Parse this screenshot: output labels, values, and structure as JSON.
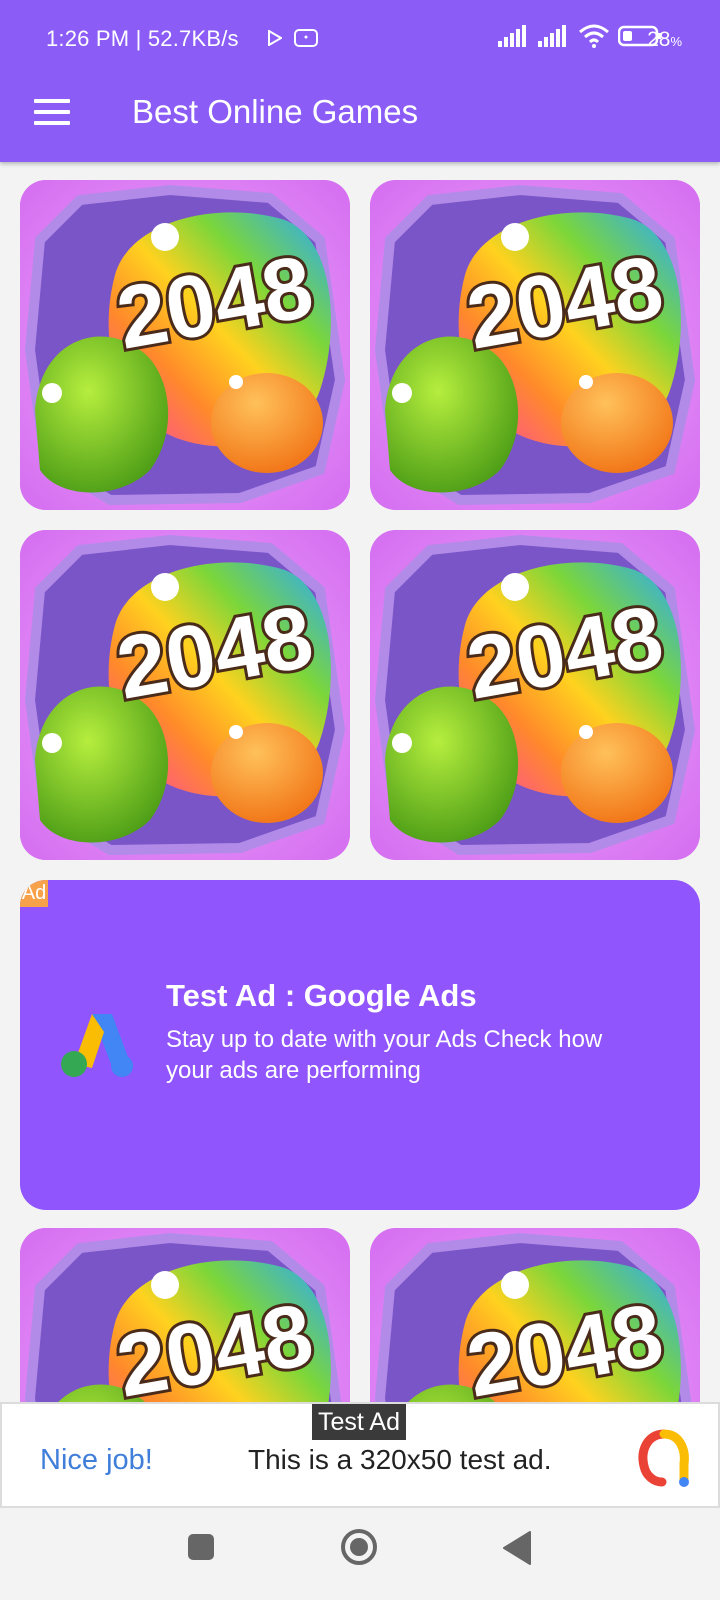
{
  "status_bar": {
    "time_speed": "1:26 PM | 52.7KB/s",
    "battery_percent": "28",
    "battery_unit": "%",
    "icons": [
      "play-icon",
      "sim-badge-icon",
      "signal-icon",
      "signal-icon",
      "wifi-icon",
      "battery-icon"
    ]
  },
  "app_bar": {
    "title": "Best Online Games",
    "menu_icon": "hamburger-menu-icon"
  },
  "games": [
    {
      "label": "2048"
    },
    {
      "label": "2048"
    },
    {
      "label": "2048"
    },
    {
      "label": "2048"
    },
    {
      "label": "2048"
    },
    {
      "label": "2048"
    }
  ],
  "native_ad": {
    "badge": "Ad",
    "headline": "Test Ad : Google Ads",
    "body": "Stay up to date with your Ads Check how your ads are performing",
    "logo_icon": "google-ads-logo-icon"
  },
  "banner_ad": {
    "tag": "Test Ad",
    "cta": "Nice job!",
    "text": "This is a 320x50 test ad.",
    "logo_icon": "admob-logo-icon"
  },
  "nav_bar": {
    "icons": [
      "recents-square-icon",
      "home-circle-icon",
      "back-triangle-icon"
    ]
  },
  "colors": {
    "app_bar": "#8b5cf6",
    "native_ad_bg": "#9055fd",
    "ad_badge": "#f7a24b",
    "tile_bg": "#e27ff6",
    "banner_cta": "#3f7ed9"
  }
}
